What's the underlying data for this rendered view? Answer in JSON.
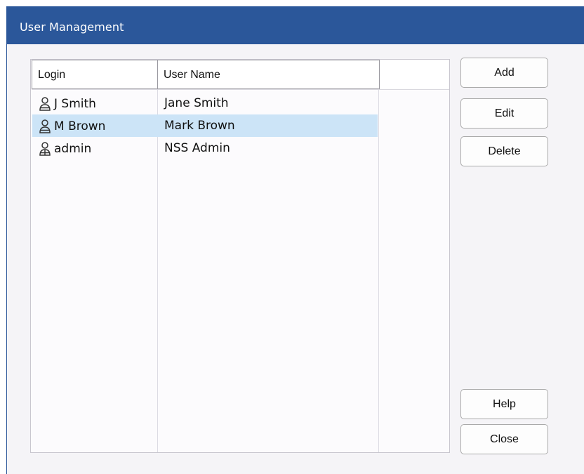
{
  "window": {
    "title": "User Management"
  },
  "list": {
    "columns": [
      "Login",
      "User Name",
      ""
    ],
    "rows": [
      {
        "login": "J Smith",
        "user_name": "Jane Smith",
        "icon": "user-icon",
        "selected": false
      },
      {
        "login": "M Brown",
        "user_name": "Mark Brown",
        "icon": "user-icon",
        "selected": true
      },
      {
        "login": "admin",
        "user_name": "NSS Admin",
        "icon": "admin-user-icon",
        "selected": false
      }
    ]
  },
  "buttons": {
    "add": "Add",
    "edit": "Edit",
    "delete": "Delete",
    "help": "Help",
    "close": "Close"
  },
  "colors": {
    "titlebar": "#2b579a",
    "selection": "#cce4f7",
    "window_bg": "#f5f4f7"
  }
}
